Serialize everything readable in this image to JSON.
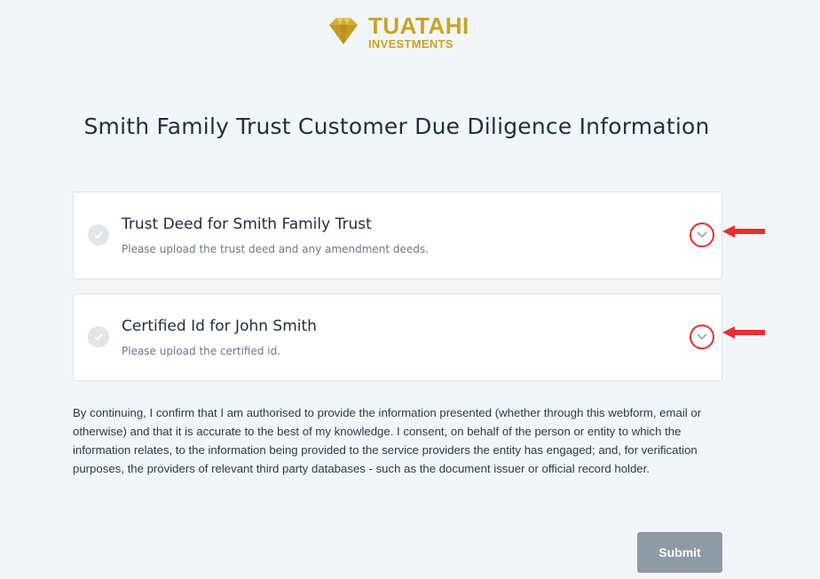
{
  "brand": {
    "name": "TUATAHI",
    "tagline": "INVESTMENTS",
    "logo_icon": "diamond-icon",
    "color": "#c9a227"
  },
  "page": {
    "title": "Smith Family Trust Customer Due Diligence Information"
  },
  "documents": [
    {
      "title": "Trust Deed for Smith Family Trust",
      "description": "Please upload the trust deed and any amendment deeds.",
      "status_icon": "check-circle-icon",
      "expand_icon": "chevron-down-icon"
    },
    {
      "title": "Certified Id for John Smith",
      "description": "Please upload the certified id.",
      "status_icon": "check-circle-icon",
      "expand_icon": "chevron-down-icon"
    }
  ],
  "annotations": {
    "highlight_color": "#e53030",
    "arrow_icon": "left-arrow-icon"
  },
  "consent": {
    "text": "By continuing, I confirm that I am authorised to provide the information presented (whether through this webform, email or otherwise) and that it is accurate to the best of my knowledge. I consent, on behalf of the person or entity to which the information relates, to the information being provided to the service providers the entity has engaged; and, for verification purposes, the providers of relevant third party databases - such as the document issuer or official record holder."
  },
  "actions": {
    "submit_label": "Submit"
  }
}
